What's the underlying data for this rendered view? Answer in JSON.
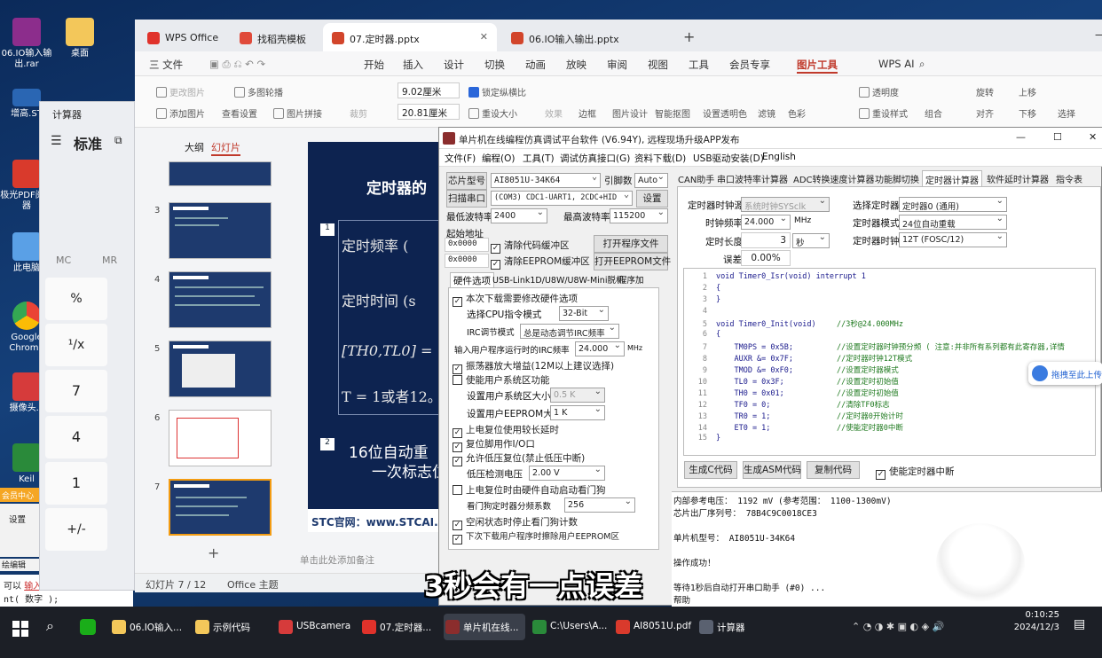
{
  "desktop": {
    "icons": [
      "06.IO输入输出.rar",
      "桌面",
      "增高.ST",
      "极光PDF阅读器",
      "此电脑",
      "Google Chrome",
      "摄像头.c",
      "Keil"
    ],
    "side_labels": [
      "会员中心",
      "设置",
      "绘编辑",
      "可以",
      "输入意码"
    ],
    "code_hint": "nt( 数字 );"
  },
  "wps": {
    "tabs": [
      "WPS Office",
      "找稻壳模板",
      "07.定时器.pptx",
      "06.IO输入输出.pptx"
    ],
    "menu": [
      "三 文件",
      "开始",
      "插入",
      "设计",
      "切换",
      "动画",
      "放映",
      "审阅",
      "视图",
      "工具",
      "会员专享",
      "图片工具",
      "WPS AI"
    ],
    "ribbon": {
      "row1": [
        "更改图片",
        "多图轮播",
        "9.02厘米",
        "锁定纵横比",
        "边框",
        "图片设计",
        "智能抠图",
        "设置透明色",
        "滤镜",
        "色彩",
        "透明度",
        "组合",
        "旋转",
        "上移",
        "选择"
      ],
      "row2": [
        "添加图片",
        "查看设置",
        "图片拼接",
        "裁剪",
        "20.81厘米",
        "重设大小",
        "效果",
        "重设样式",
        "对齐",
        "下移"
      ]
    },
    "panel_tabs": [
      "大纲",
      "幻灯片"
    ],
    "slide_numbers": [
      "3",
      "4",
      "5",
      "6",
      "7"
    ],
    "slide": {
      "title": "定时器的",
      "lines": [
        "定时频率 (",
        "定时时间 (s",
        "[TH0,TL0] =",
        "T = 1或者12。",
        "16位自动重",
        "一次标志位"
      ],
      "badges": [
        "1",
        "2"
      ],
      "footer": "STC官网：www.STCAI."
    },
    "status": {
      "slide_count": "幻灯片 7 / 12",
      "theme": "Office 主题",
      "notes": "单击此处添加备注"
    }
  },
  "calc": {
    "title": "计算器",
    "mode": "标准",
    "mem": [
      "MC",
      "MR"
    ],
    "buttons": [
      "%",
      "¹/x",
      "7",
      "4",
      "1",
      "+/-"
    ]
  },
  "isp": {
    "title": "单片机在线编程仿真调试平台软件 (V6.94Y), 远程现场升级APP发布",
    "menu": [
      "文件(F)",
      "编程(O)",
      "工具(T)",
      "调试仿真接口(G)",
      "资料下载(D)",
      "USB驱动安装(D)",
      "English"
    ],
    "chip_label": "芯片型号",
    "chip": "AI8051U-34K64",
    "pins_label": "引脚数",
    "pins": "Auto",
    "scan_btn": "扫描串口",
    "port": "(COM3) CDC1-UART1, 2CDC+HID",
    "set_btn": "设置",
    "min_baud_label": "最低波特率",
    "min_baud": "2400",
    "max_baud_label": "最高波特率",
    "max_baud": "115200",
    "start_addr": "起始地址",
    "addr1": "0x0000",
    "addr2": "0x0000",
    "clr_code": "清除代码缓冲区",
    "clr_eeprom": "清除EEPROM缓冲区",
    "open_prog": "打开程序文件",
    "open_eeprom": "打开EEPROM文件",
    "hw_tabs": [
      "硬件选项",
      "USB-Link1D/U8W/U8W-Mini脱机",
      "程序加"
    ],
    "hw_options": [
      "本次下载需要修改硬件选项",
      "选择CPU指令模式",
      "32-Bit",
      "IRC调节模式",
      "总是动态调节IRC频率",
      "输入用户程序运行时的IRC频率",
      "24.000",
      "MHz",
      "振荡器放大增益(12M以上建议选择)",
      "使能用户系统区功能",
      "设置用户系统区大小",
      "0.5 K",
      "设置用户EEPROM大小",
      "1 K",
      "上电复位使用较长延时",
      "复位脚用作I/O口",
      "允许低压复位(禁止低压中断)",
      "低压检测电压",
      "2.00 V",
      "上电复位时由硬件自动启动看门狗",
      "看门狗定时器分频系数",
      "256",
      "空闲状态时停止看门狗计数",
      "下次下载用户程序时擦除用户EEPROM区"
    ],
    "tool_tabs": [
      "CAN助手",
      "串口波特率计算器",
      "ADC转换速度计算器",
      "功能脚切换",
      "定时器计算器",
      "软件延时计算器",
      "指令表"
    ],
    "timer": {
      "clock_src_label": "定时器时钟源",
      "clock_src": "系统时钟SYSclk",
      "freq_label": "时钟频率",
      "freq": "24.000",
      "freq_unit": "MHz",
      "len_label": "定时长度",
      "len": "3",
      "len_unit": "秒",
      "err_label": "误差",
      "err": "0.00%",
      "sel_timer_label": "选择定时器",
      "sel_timer": "定时器0 (通用)",
      "mode_label": "定时器模式",
      "mode": "24位自动重载",
      "tclk_label": "定时器时钟",
      "tclk": "12T (FOSC/12)"
    },
    "code": [
      [
        "1",
        "void Timer0_Isr(void) interrupt 1",
        ""
      ],
      [
        "2",
        "{",
        ""
      ],
      [
        "3",
        "}",
        ""
      ],
      [
        "4",
        "",
        ""
      ],
      [
        "5",
        "void Timer0_Init(void)",
        "//3秒@24.000MHz"
      ],
      [
        "6",
        "{",
        ""
      ],
      [
        "7",
        "    TM0PS = 0x5B;",
        "//设置定时器时钟预分频 ( 注意:并非所有系列都有此寄存器,详情"
      ],
      [
        "8",
        "    AUXR &= 0x7F;",
        "//定时器时钟12T模式"
      ],
      [
        "9",
        "    TMOD &= 0xF0;",
        "//设置定时器模式"
      ],
      [
        "10",
        "    TL0 = 0x3F;",
        "//设置定时初始值"
      ],
      [
        "11",
        "    TH0 = 0x01;",
        "//设置定时初始值"
      ],
      [
        "12",
        "    TF0 = 0;",
        "//清除TF0标志"
      ],
      [
        "13",
        "    TR0 = 1;",
        "//定时器0开始计时"
      ],
      [
        "14",
        "    ET0 = 1;",
        "//使能定时器0中断"
      ],
      [
        "15",
        "}",
        ""
      ]
    ],
    "gen_c": "生成C代码",
    "gen_asm": "生成ASM代码",
    "copy_code": "复制代码",
    "enable_int": "使能定时器中断",
    "drag_hint": "拖拽至此上传",
    "log": [
      "内部参考电压： 1192 mV (参考范围： 1100-1300mV)",
      "芯片出厂序列号： 78B4C9C0018CE3",
      "",
      "单片机型号： AI8051U-34K64",
      "",
      "操作成功！",
      "",
      "等待1秒后自动打开串口助手 (#0) ...",
      "帮助"
    ]
  },
  "subtitle": "3秒会有一点误差",
  "taskbar": {
    "items": [
      "06.IO输入...",
      "示例代码",
      "USBcamera",
      "07.定时器...",
      "单片机在线...",
      "C:\\Users\\A...",
      "AI8051U.pdf",
      "计算器"
    ],
    "time": "0:10:25",
    "date": "2024/12/3"
  }
}
